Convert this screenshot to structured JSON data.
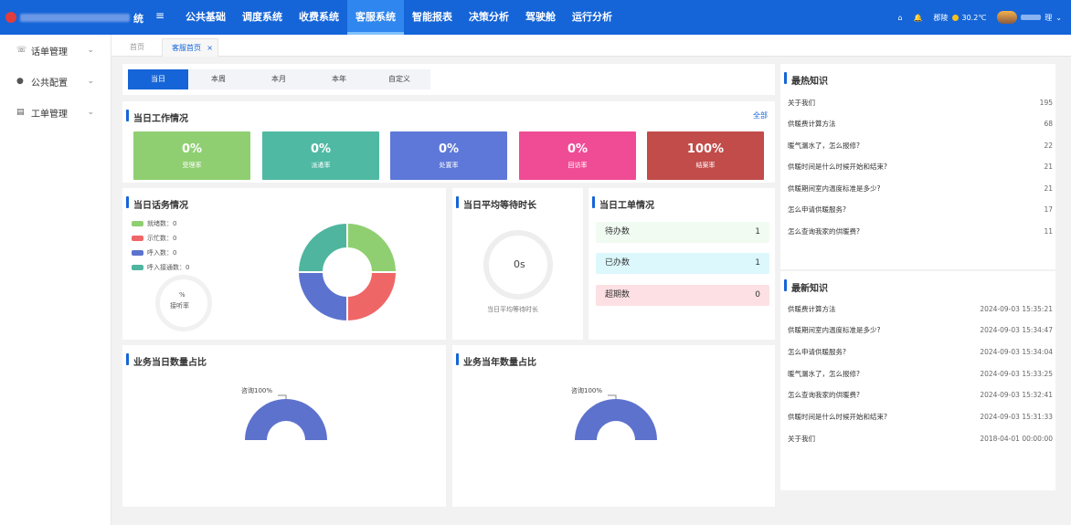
{
  "header": {
    "title_suffix": "统",
    "nav": [
      "公共基础",
      "调度系统",
      "收费系统",
      "客服系统",
      "智能报表",
      "决策分析",
      "驾驶舱",
      "运行分析"
    ],
    "active_nav": "客服系统",
    "weather_city": "郡陵",
    "temperature": "30.2℃",
    "user_suffix": "理"
  },
  "sidebar": {
    "items": [
      "话单管理",
      "公共配置",
      "工单管理"
    ]
  },
  "tabs": [
    "首页",
    "客服首页"
  ],
  "date_tabs": [
    "当日",
    "本周",
    "本月",
    "本年",
    "自定义"
  ],
  "today_work": {
    "title": "当日工作情况",
    "all_label": "全部",
    "stats": [
      {
        "value": "0%",
        "label": "受理率",
        "color": "#8fcf71"
      },
      {
        "value": "0%",
        "label": "派遣率",
        "color": "#50b9a3"
      },
      {
        "value": "0%",
        "label": "处置率",
        "color": "#5d78d8"
      },
      {
        "value": "0%",
        "label": "回访率",
        "color": "#f04c96"
      },
      {
        "value": "100%",
        "label": "结案率",
        "color": "#c14c4a"
      }
    ]
  },
  "today_calls": {
    "title": "当日话务情况",
    "legend": [
      {
        "label": "就绪数：0",
        "color": "#8fcf71"
      },
      {
        "label": "示忙数：0",
        "color": "#ef6666"
      },
      {
        "label": "呼入数：0",
        "color": "#5b73cf"
      },
      {
        "label": "呼入接通数：0",
        "color": "#4fb59e"
      }
    ],
    "pct": "%",
    "pct_label": "接听率"
  },
  "avg_wait": {
    "title": "当日平均等待时长",
    "value": "0s",
    "label": "当日平均等待时长"
  },
  "orders": {
    "title": "当日工单情况",
    "items": [
      {
        "label": "待办数",
        "count": "1",
        "bg": "#f1fbf2"
      },
      {
        "label": "已办数",
        "count": "1",
        "bg": "#dcf8fc"
      },
      {
        "label": "超期数",
        "count": "0",
        "bg": "#fde0e3"
      }
    ]
  },
  "business_daily": {
    "title": "业务当日数量占比",
    "label": "咨询100%"
  },
  "business_yearly": {
    "title": "业务当年数量占比",
    "label": "咨询100%"
  },
  "hot_knowledge": {
    "title": "最热知识",
    "items": [
      {
        "text": "关于我们",
        "value": "195"
      },
      {
        "text": "供暖费计算方法",
        "value": "68"
      },
      {
        "text": "暖气漏水了，怎么报修?",
        "value": "22"
      },
      {
        "text": "供暖时间是什么时候开始和结束?",
        "value": "21"
      },
      {
        "text": "供暖期间室内温度标准是多少?",
        "value": "21"
      },
      {
        "text": "怎么申请供暖服务?",
        "value": "17"
      },
      {
        "text": "怎么查询我家的供暖费?",
        "value": "11"
      }
    ]
  },
  "latest_knowledge": {
    "title": "最新知识",
    "items": [
      {
        "text": "供暖费计算方法",
        "value": "2024-09-03 15:35:21"
      },
      {
        "text": "供暖期间室内温度标准是多少?",
        "value": "2024-09-03 15:34:47"
      },
      {
        "text": "怎么申请供暖服务?",
        "value": "2024-09-03 15:34:04"
      },
      {
        "text": "暖气漏水了，怎么报修?",
        "value": "2024-09-03 15:33:25"
      },
      {
        "text": "怎么查询我家的供暖费?",
        "value": "2024-09-03 15:32:41"
      },
      {
        "text": "供暖时间是什么时候开始和结束?",
        "value": "2024-09-03 15:31:33"
      },
      {
        "text": "关于我们",
        "value": "2018-04-01 00:00:00"
      }
    ]
  }
}
